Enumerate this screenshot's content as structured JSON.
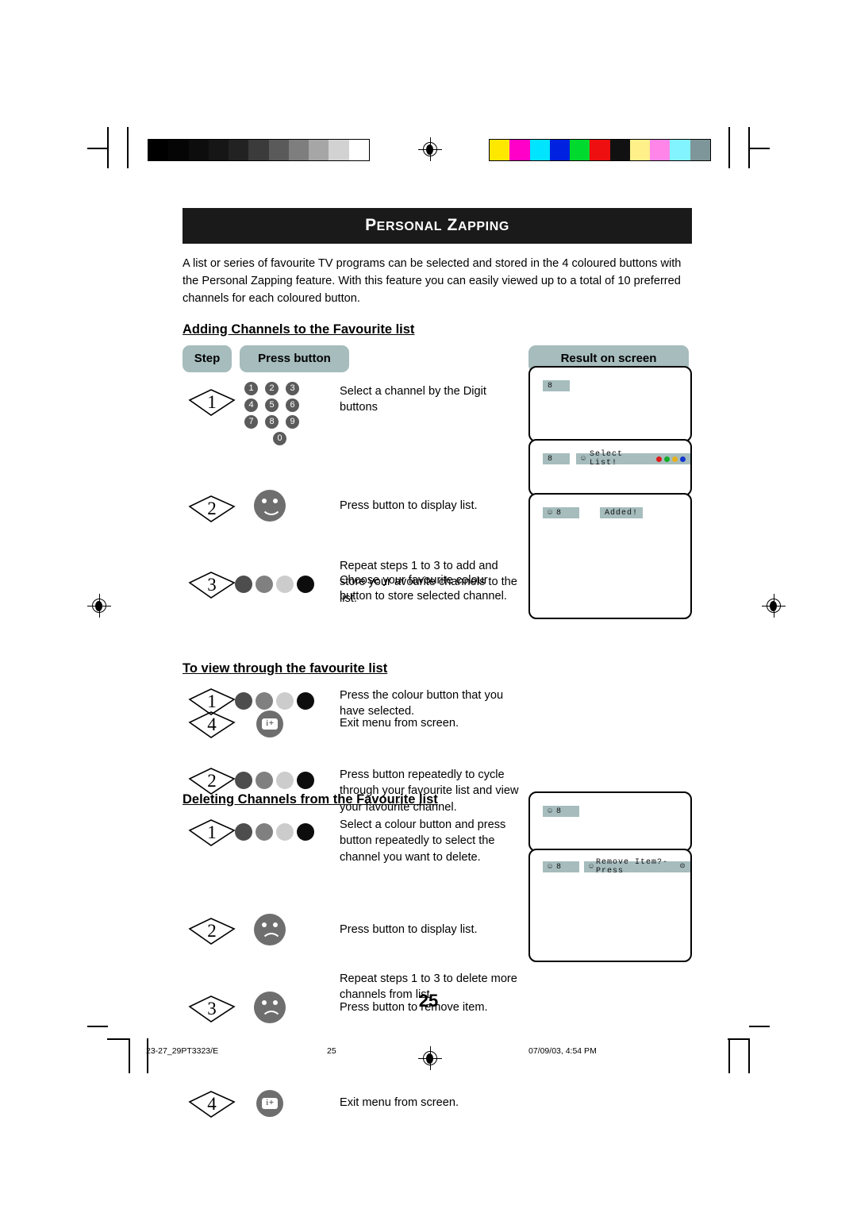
{
  "document": {
    "title_first_letter": "P",
    "title_rest": "ERSONAL",
    "title2_first_letter": "Z",
    "title2_rest": "APPING",
    "intro": "A list or series of favourite TV programs can be selected and stored in the 4 coloured buttons with the Personal Zapping feature. With this feature you can easily viewed up to a total of 10 preferred channels for each coloured button.",
    "page_number": "25"
  },
  "table_headers": {
    "step": "Step",
    "press_button": "Press button",
    "result_on_screen": "Result on screen"
  },
  "sections": {
    "adding": {
      "heading": "Adding Channels to the Favourite list",
      "steps": [
        {
          "number": "1",
          "description": "Select a channel by the Digit buttons",
          "icon": "digit-keypad"
        },
        {
          "number": "2",
          "description": "Press button to display list.",
          "icon": "smiley-button"
        },
        {
          "number": "3",
          "description": "Choose your favourite colour button to store selected channel.",
          "icon": "colour-buttons"
        },
        {
          "number": "4",
          "description": "Exit menu from screen.",
          "icon": "menu-exit-button"
        }
      ],
      "note": "Repeat steps 1 to 3 to add and store your avourite channels to the list."
    },
    "viewing": {
      "heading": "To view through the favourite list",
      "steps": [
        {
          "number": "1",
          "description": "Press the colour button that you have selected.",
          "icon": "colour-buttons"
        },
        {
          "number": "2",
          "description": "Press button repeatedly to cycle through your favourite list and view your favourite channel.",
          "icon": "colour-buttons"
        }
      ]
    },
    "deleting": {
      "heading": "Deleting Channels from the Favourite list",
      "steps": [
        {
          "number": "1",
          "description": "Select a colour button and press button repeatedly to select the channel you want to delete.",
          "icon": "colour-buttons"
        },
        {
          "number": "2",
          "description": "Press button to display list.",
          "icon": "sad-face-button"
        },
        {
          "number": "3",
          "description": "Press button to remove item.",
          "icon": "sad-face-button"
        },
        {
          "number": "4",
          "description": "Exit menu from screen.",
          "icon": "menu-exit-button"
        }
      ],
      "note": "Repeat steps 1 to 3 to delete more channels from list."
    }
  },
  "keypad": {
    "keys": [
      "1",
      "2",
      "3",
      "4",
      "5",
      "6",
      "7",
      "8",
      "9",
      "0"
    ]
  },
  "colour_buttons": {
    "shades": [
      "#4d4d4d",
      "#808080",
      "#cccccc",
      "#0d0d0d"
    ]
  },
  "tv_screens": {
    "adding": [
      {
        "channel": "8"
      },
      {
        "channel": "8",
        "message": "Select List!",
        "dots": [
          "#e01b1b",
          "#13ad27",
          "#e8b01c",
          "#1536cf"
        ]
      },
      {
        "channel": "8",
        "message": "Added!"
      }
    ],
    "deleting": [
      {
        "channel": "8"
      },
      {
        "channel": "8",
        "message": "Remove Item?- Press"
      }
    ]
  },
  "osd_glyphs": {
    "smiley": "☺",
    "frown": "☹"
  },
  "exit_icon": {
    "letter": "i",
    "plus": "+"
  },
  "footer": {
    "file_reference": "23-27_29PT3323/E",
    "page": "25",
    "timestamp": "07/09/03, 4:54 PM"
  },
  "calibration": {
    "grayscale": [
      "#000000",
      "#050505",
      "#0d0d0d",
      "#161616",
      "#222222",
      "#3b3b3b",
      "#5a5a5a",
      "#7e7e7e",
      "#a6a6a6",
      "#d2d2d2",
      "#ffffff"
    ],
    "colour": [
      "#ffe800",
      "#ff00c8",
      "#00e4ff",
      "#0022e0",
      "#00d92e",
      "#ee1010",
      "#111111",
      "#fff089",
      "#ff86e8",
      "#82f4ff",
      "#7e9699"
    ]
  }
}
